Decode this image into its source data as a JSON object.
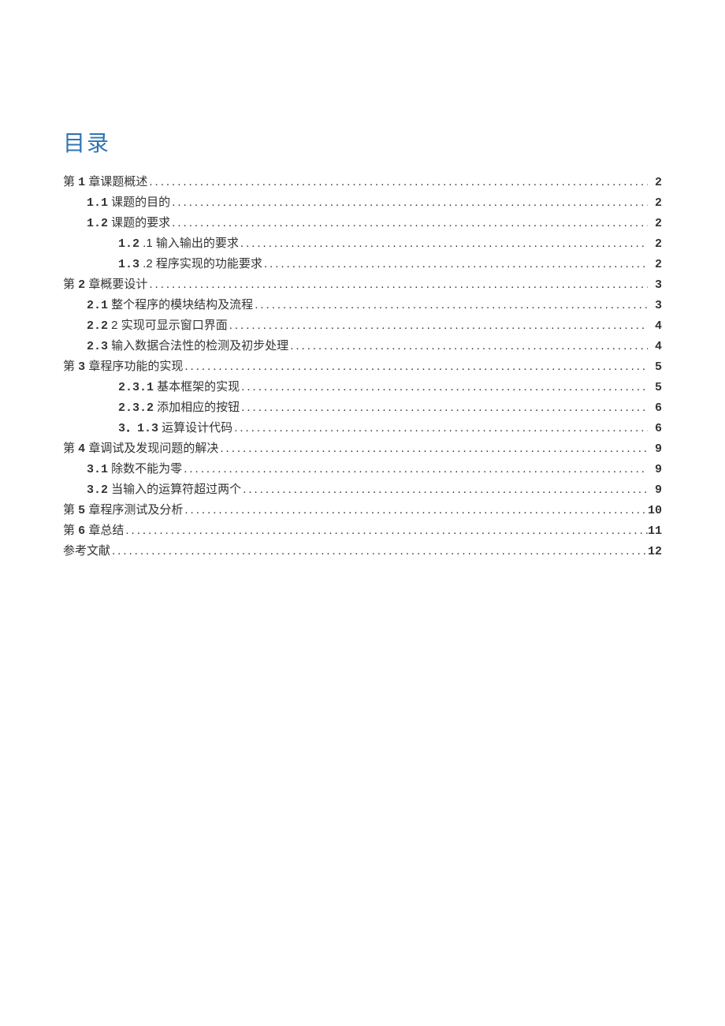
{
  "title": "目录",
  "toc": [
    {
      "level": 0,
      "label_pre": "第 ",
      "label_num": "1",
      "label_post": " 章课题概述",
      "page": "2"
    },
    {
      "level": 1,
      "label_pre": "",
      "label_num": "1.1",
      "label_post": " 课题的目的 ",
      "page": "2"
    },
    {
      "level": 1,
      "label_pre": "",
      "label_num": "1.2",
      "label_post": " 课题的要求 ",
      "page": "2"
    },
    {
      "level": 2,
      "label_pre": "",
      "label_num": "1.2",
      "label_post": " .1 输入输出的要求 ",
      "page": "2"
    },
    {
      "level": 2,
      "label_pre": "",
      "label_num": "1.3",
      "label_post": " .2 程序实现的功能要求 ",
      "page": "2"
    },
    {
      "level": 0,
      "label_pre": "第 ",
      "label_num": "2",
      "label_post": " 章概要设计",
      "page": "3"
    },
    {
      "level": 1,
      "label_pre": "",
      "label_num": "2.1",
      "label_post": "  整个程序的模块结构及流程 ",
      "page": "3"
    },
    {
      "level": 1,
      "label_pre": "",
      "label_num": "2.2",
      "label_post": " 2 实现可显示窗口界面",
      "page": "4"
    },
    {
      "level": 1,
      "label_pre": "",
      "label_num": "2.3",
      "label_post": "  输入数据合法性的检测及初步处理 ",
      "page": "4"
    },
    {
      "level": 0,
      "label_pre": "第 ",
      "label_num": "3",
      "label_post": " 章程序功能的实现",
      "page": "5"
    },
    {
      "level": 2,
      "label_pre": "",
      "label_num": "2.3.1",
      "label_post": "  基本框架的实现",
      "page": "5"
    },
    {
      "level": 2,
      "label_pre": "",
      "label_num": "2.3.2",
      "label_post": "  添加相应的按钮",
      "page": "6"
    },
    {
      "level": 2,
      "label_pre": "",
      "label_num": "3．1.3",
      "label_post": " 运算设计代码",
      "page": "6"
    },
    {
      "level": 0,
      "label_pre": "第 ",
      "label_num": "4",
      "label_post": " 章调试及发现问题的解决",
      "page": "9"
    },
    {
      "level": 1,
      "label_pre": "",
      "label_num": "3.1",
      "label_post": "  除数不能为零",
      "page": "9"
    },
    {
      "level": 1,
      "label_pre": "",
      "label_num": "3.2",
      "label_post": "  当输入的运算符超过两个 ",
      "page": "9"
    },
    {
      "level": 0,
      "label_pre": "第 ",
      "label_num": "5",
      "label_post": " 章程序测试及分析",
      "page": "10"
    },
    {
      "level": 0,
      "label_pre": "第 ",
      "label_num": "6",
      "label_post": " 章总结",
      "page": "11"
    },
    {
      "level": 0,
      "label_pre": "参考文献",
      "label_num": "",
      "label_post": "",
      "page": "12"
    }
  ]
}
